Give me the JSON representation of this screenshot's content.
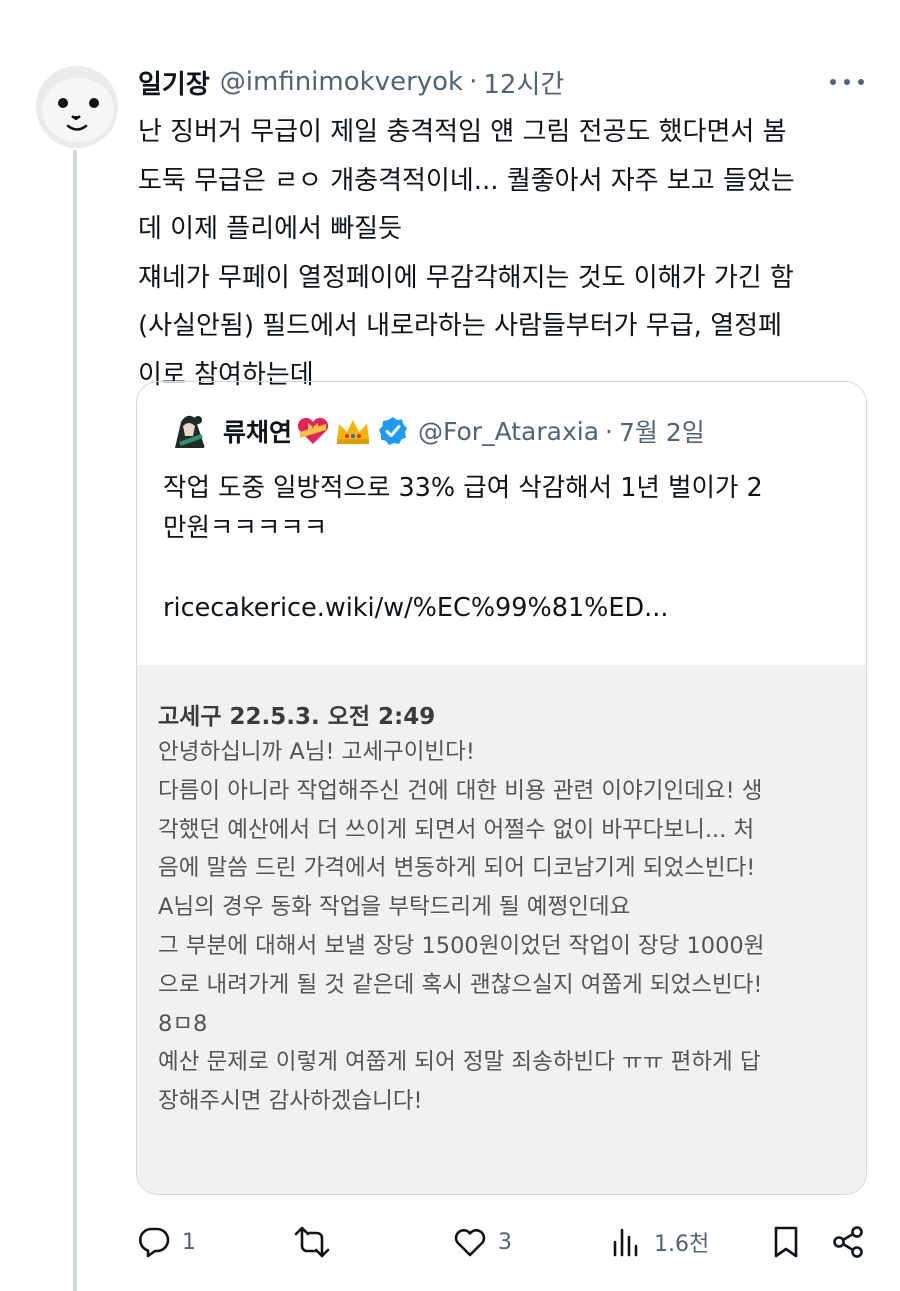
{
  "post": {
    "author_name": "일기장",
    "author_handle": "@imfinimokveryok",
    "separator": "·",
    "time": "12시간",
    "more_icon": "more-horizontal-icon",
    "body_lines": [
      "난 징버거 무급이 제일 충격적임 얜 그림 전공도 했다면서 봄",
      "도둑 무급은 ㄹㅇ 개충격적이네... 퀄좋아서 자주 보고 들었는",
      "데 이제 플리에서 빠질듯",
      "쟤네가 무페이 열정페이에 무감각해지는 것도 이해가 가긴 함",
      "(사실안됨) 필드에서 내로라하는 사람들부터가 무급, 열정페",
      "이로 참여하는데"
    ]
  },
  "quote": {
    "author_name": "류채연",
    "emojis": [
      "heart-ribbon-emoji",
      "crown-emoji"
    ],
    "verified_icon": "verified-badge-icon",
    "author_handle": "@For_Ataraxia",
    "separator": "·",
    "date": "7월 2일",
    "text_lines": [
      "작업 도중 일방적으로 33% 급여 삭감해서 1년 벌이가 2",
      "만원ㅋㅋㅋㅋㅋ"
    ],
    "link": "ricecakerice.wiki/w/%EC%99%81%ED...",
    "message": {
      "sender_line": "고세구 22.5.3. 오전 2:49",
      "lines": [
        "안녕하십니까 A님! 고세구이빈다!",
        "다름이 아니라 작업해주신 건에 대한 비용 관련 이야기인데요! 생",
        "각했던 예산에서 더 쓰이게 되면서 어쩔수 없이 바꾸다보니... 처",
        "음에 말씀 드린 가격에서 변동하게 되어 디코남기게 되었스빈다!",
        "A님의 경우 동화 작업을 부탁드리게 될 예쩡인데요",
        "그 부분에 대해서 보낼 장당 1500원이었던 작업이 장당 1000원",
        "으로 내려가게 될 것 같은데 혹시 괜찮으실지 여쭙게 되었스빈다!",
        "8ㅁ8",
        "예산 문제로 이렇게 여쭙게 되어 정말 죄송하빈다 ㅠㅠ 편하게 답",
        "장해주시면 감사하겠습니다!"
      ]
    }
  },
  "actions": {
    "reply": {
      "icon": "reply-icon",
      "count": "1"
    },
    "repost": {
      "icon": "repost-icon",
      "count": ""
    },
    "like": {
      "icon": "heart-icon",
      "count": "3"
    },
    "views": {
      "icon": "views-chart-icon",
      "count": "1.6천"
    },
    "bookmark": {
      "icon": "bookmark-icon"
    },
    "share": {
      "icon": "share-icon"
    }
  },
  "colors": {
    "text": "#0f1419",
    "secondary": "#536471",
    "border": "#cfd9de",
    "verified": "#1d9bf0",
    "message_bg": "#f1f1f1"
  }
}
